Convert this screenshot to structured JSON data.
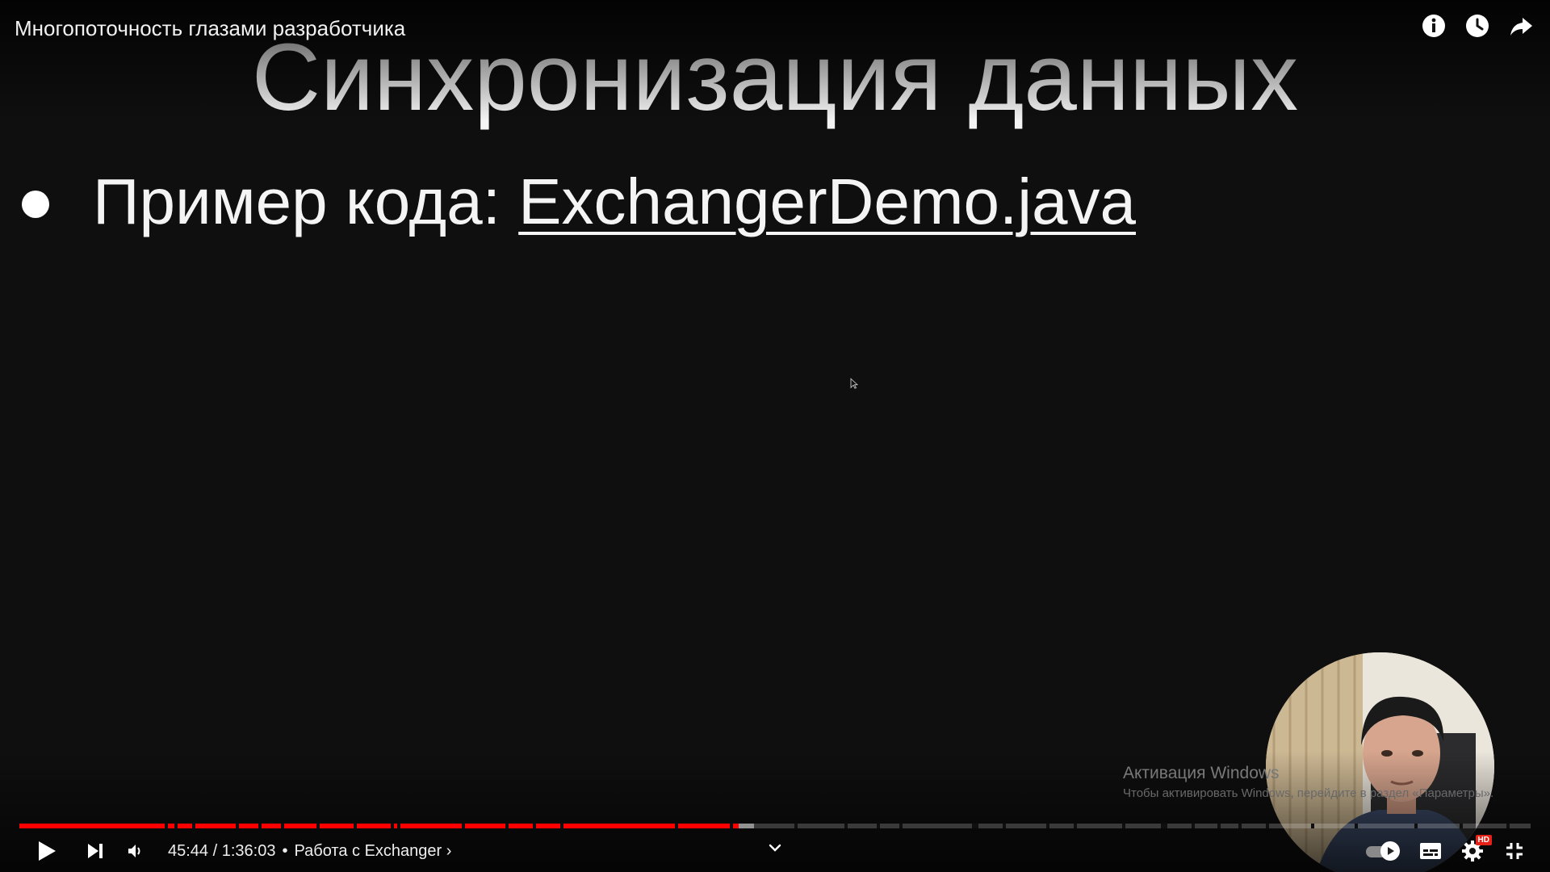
{
  "header": {
    "video_title": "Многопоточность глазами разработчика",
    "icons": [
      "info-icon",
      "watch-later-icon",
      "share-icon"
    ]
  },
  "slide": {
    "title": "Синхронизация данных",
    "bullet_prefix": "Пример кода: ",
    "bullet_link": "ExchangerDemo.java"
  },
  "watermark": {
    "title": "Активация Windows",
    "subtitle": "Чтобы активировать Windows, перейдите в раздел «Параметры»."
  },
  "player": {
    "current_time": "45:44",
    "duration": "1:36:03",
    "time_display": "45:44 / 1:36:03",
    "separator": "•",
    "chapter_title": "Работа с Exchanger",
    "chapter_chevron": "›",
    "played_fraction": 0.476,
    "buffered_fraction": 0.486,
    "accent_color": "#ff0000",
    "quality_badge": "HD",
    "autoplay": true
  }
}
